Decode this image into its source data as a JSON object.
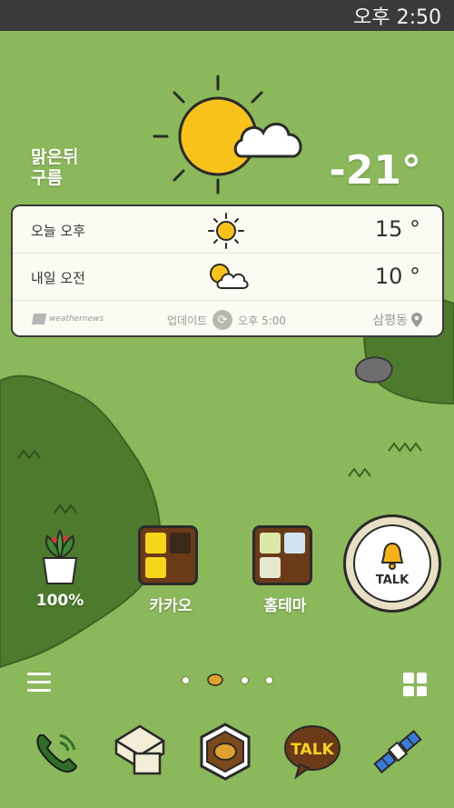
{
  "status_bar": {
    "time": "오후 2:50"
  },
  "weather": {
    "condition_line1": "맑은뒤",
    "condition_line2": "구름",
    "current_temp": "-21°",
    "forecast": [
      {
        "label": "오늘 오후",
        "icon": "sun-icon",
        "temp": "15 °"
      },
      {
        "label": "내일 오전",
        "icon": "sun-cloud-icon",
        "temp": "10 °"
      }
    ],
    "provider": "weathernews",
    "update_label": "업데이트",
    "update_time": "오후 5:00",
    "location": "삼평동"
  },
  "home": {
    "apps": [
      {
        "label": "100%",
        "icon": "plant-battery-icon"
      },
      {
        "label": "카카오",
        "icon": "kakao-folder-icon"
      },
      {
        "label": "홈테마",
        "icon": "home-theme-folder-icon"
      }
    ],
    "alarm_widget_text": "TALK",
    "page_count": 4,
    "current_page": 1
  },
  "dock": {
    "apps": [
      {
        "icon": "phone-icon"
      },
      {
        "icon": "message-icon"
      },
      {
        "icon": "kakao-story-icon"
      },
      {
        "icon": "kakao-talk-icon",
        "text": "TALK"
      },
      {
        "icon": "satellite-icon"
      }
    ]
  },
  "colors": {
    "background": "#8ab85a",
    "bush": "#4e7a2e",
    "status_bar": "#3a3a3a",
    "sun": "#f7c21a",
    "kakao_brown": "#6b3a18"
  }
}
